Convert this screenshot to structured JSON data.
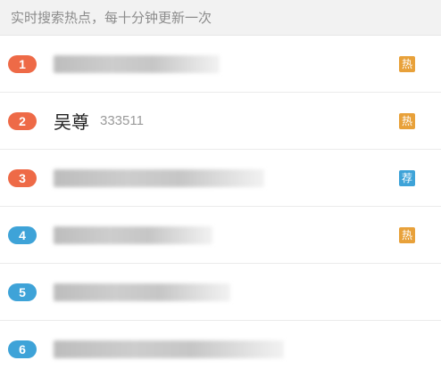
{
  "header": {
    "text": "实时搜索热点，每十分钟更新一次"
  },
  "colors": {
    "hot": "#e8a13a",
    "recommend": "#3ea3d8",
    "rank_top": "#ee6a47",
    "rank_other": "#3ea3d8"
  },
  "items": [
    {
      "rank": "1",
      "title": "",
      "count": "",
      "badge": "热",
      "badge_type": "hot",
      "rank_color": "#ee6a47",
      "blur_width": 186
    },
    {
      "rank": "2",
      "title": "吴尊",
      "count": "333511",
      "badge": "热",
      "badge_type": "hot",
      "rank_color": "#ee6a47",
      "blur_width": 0
    },
    {
      "rank": "3",
      "title": "",
      "count": "",
      "badge": "荐",
      "badge_type": "recommend",
      "rank_color": "#ee6a47",
      "blur_width": 236
    },
    {
      "rank": "4",
      "title": "",
      "count": "",
      "badge": "热",
      "badge_type": "hot",
      "rank_color": "#3ea3d8",
      "blur_width": 178
    },
    {
      "rank": "5",
      "title": "",
      "count": "",
      "badge": "",
      "badge_type": "",
      "rank_color": "#3ea3d8",
      "blur_width": 198
    },
    {
      "rank": "6",
      "title": "",
      "count": "",
      "badge": "",
      "badge_type": "",
      "rank_color": "#3ea3d8",
      "blur_width": 258
    }
  ]
}
